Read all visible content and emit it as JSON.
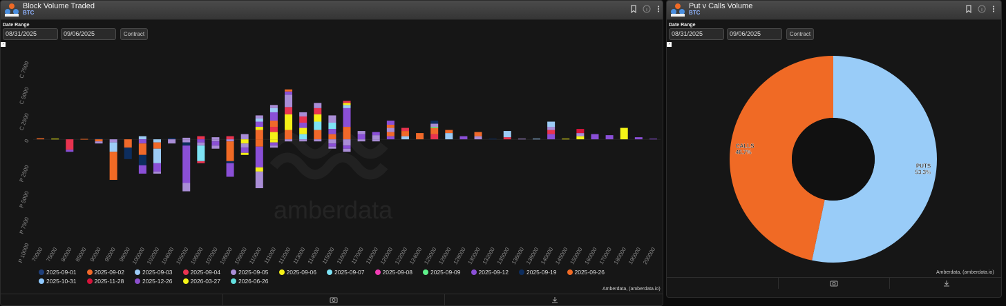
{
  "left_panel": {
    "title": "Block Volume Traded",
    "subtitle": "BTC",
    "date_range_label": "Date Range",
    "date_from": "08/31/2025",
    "date_to": "09/06/2025",
    "contract_button": "Contract",
    "credit": "Amberdata, (amberdata.io)",
    "watermark": "amberdata"
  },
  "right_panel": {
    "title": "Put v Calls Volume",
    "subtitle": "BTC",
    "date_from": "08/31/2025",
    "date_to": "09/06/2025",
    "contract_button": "Contract",
    "credit": "Amberdata, (amberdata.io)"
  },
  "icons": [
    "amberdata-logo-icon",
    "bookmark-icon",
    "info-icon",
    "more-vert-icon",
    "camera-icon",
    "download-icon"
  ],
  "colors": {
    "2025-09-01": "#1f3f7a",
    "2025-09-02": "#f0692a",
    "2025-09-03": "#9ccbf5",
    "2025-09-04": "#e8334f",
    "2025-09-05": "#a98dd6",
    "2025-09-06": "#f5f017",
    "2025-09-07": "#7de3f5",
    "2025-09-08": "#f03cb4",
    "2025-09-09": "#5ef08a",
    "2025-09-12": "#8a4fd6",
    "2025-09-19": "#0d2d5e",
    "2025-09-26": "#f06a25",
    "2025-10-31": "#8fc9ff",
    "2025-11-28": "#d6133a",
    "2025-12-26": "#8b4fcc",
    "2026-03-27": "#f5f517",
    "2026-06-26": "#62dede"
  },
  "chart_data": [
    {
      "type": "bar",
      "stacked": true,
      "y_tick_labels": [
        "C 7500",
        "C 5000",
        "C 2500",
        "0",
        "P 2500",
        "P 5000",
        "P 7500",
        "P 10000"
      ],
      "ylim": [
        -10000,
        7500
      ],
      "categories": [
        "70000",
        "75000",
        "80000",
        "85000",
        "90000",
        "95000",
        "98000",
        "100000",
        "102000",
        "104000",
        "105000",
        "106000",
        "107000",
        "108000",
        "109000",
        "110000",
        "111000",
        "112000",
        "113000",
        "114000",
        "115000",
        "116000",
        "117000",
        "118000",
        "120000",
        "122000",
        "124000",
        "125000",
        "126000",
        "128000",
        "130000",
        "132000",
        "135000",
        "136000",
        "138000",
        "140000",
        "145000",
        "150000",
        "160000",
        "170000",
        "180000",
        "190000",
        "200000"
      ],
      "legend": [
        "2025-09-01",
        "2025-09-02",
        "2025-09-03",
        "2025-09-04",
        "2025-09-05",
        "2025-09-06",
        "2025-09-07",
        "2025-09-08",
        "2025-09-09",
        "2025-09-12",
        "2025-09-19",
        "2025-09-26",
        "2025-10-31",
        "2025-11-28",
        "2025-12-26",
        "2026-03-27",
        "2026-06-26"
      ],
      "calls": [
        [
          [
            "2025-09-26",
            100
          ]
        ],
        [
          [
            "2026-03-27",
            60
          ]
        ],
        [],
        [
          [
            "2025-09-26",
            40
          ]
        ],
        [
          [
            "2025-09-19",
            80
          ]
        ],
        [],
        [],
        [
          [
            "2025-09-03",
            300
          ]
        ],
        [],
        [
          [
            "2025-09-19",
            120
          ]
        ],
        [
          [
            "2025-09-05",
            150
          ]
        ],
        [
          [
            "2025-09-04",
            300
          ]
        ],
        [
          [
            "2025-09-05",
            200
          ]
        ],
        [
          [
            "2025-09-04",
            300
          ]
        ],
        [
          [
            "2025-09-05",
            500
          ]
        ],
        [
          [
            "2025-09-02",
            900
          ],
          [
            "2025-09-06",
            300
          ],
          [
            "2025-09-12",
            500
          ],
          [
            "2025-09-03",
            300
          ],
          [
            "2025-09-05",
            300
          ]
        ],
        [
          [
            "2025-09-06",
            700
          ],
          [
            "2025-09-04",
            500
          ],
          [
            "2025-09-02",
            600
          ],
          [
            "2025-09-12",
            800
          ],
          [
            "2025-09-03",
            400
          ],
          [
            "2025-09-05",
            300
          ]
        ],
        [
          [
            "2025-09-02",
            900
          ],
          [
            "2025-09-06",
            1500
          ],
          [
            "2025-09-04",
            700
          ],
          [
            "2025-09-05",
            1200
          ],
          [
            "2025-09-12",
            300
          ],
          [
            "2025-09-26",
            200
          ]
        ],
        [
          [
            "2025-09-07",
            500
          ],
          [
            "2025-09-06",
            600
          ],
          [
            "2025-09-12",
            500
          ],
          [
            "2025-09-04",
            600
          ],
          [
            "2025-09-05",
            400
          ]
        ],
        [
          [
            "2025-09-02",
            900
          ],
          [
            "2025-09-07",
            800
          ],
          [
            "2025-09-06",
            700
          ],
          [
            "2025-09-04",
            600
          ],
          [
            "2025-09-05",
            500
          ]
        ],
        [
          [
            "2025-09-02",
            500
          ],
          [
            "2025-09-12",
            500
          ],
          [
            "2025-09-07",
            600
          ],
          [
            "2025-09-05",
            700
          ]
        ],
        [
          [
            "2025-09-02",
            1200
          ],
          [
            "2025-09-12",
            1800
          ],
          [
            "2025-09-03",
            300
          ],
          [
            "2025-09-06",
            200
          ],
          [
            "2025-09-04",
            200
          ]
        ],
        [
          [
            "2025-09-12",
            500
          ],
          [
            "2025-09-05",
            300
          ]
        ],
        [
          [
            "2025-09-05",
            400
          ],
          [
            "2025-09-12",
            300
          ]
        ],
        [
          [
            "2025-09-12",
            300
          ],
          [
            "2025-09-02",
            400
          ],
          [
            "2025-09-05",
            400
          ],
          [
            "2025-09-26",
            300
          ],
          [
            "2025-09-12",
            400
          ]
        ],
        [
          [
            "2025-09-03",
            300
          ],
          [
            "2025-09-02",
            500
          ],
          [
            "2025-09-04",
            300
          ]
        ],
        [
          [
            "2025-09-02",
            600
          ]
        ],
        [
          [
            "2025-09-04",
            500
          ],
          [
            "2025-09-02",
            600
          ],
          [
            "2025-09-09",
            100
          ],
          [
            "2025-09-05",
            300
          ],
          [
            "2025-09-19",
            300
          ]
        ],
        [
          [
            "2025-09-03",
            600
          ],
          [
            "2025-09-02",
            300
          ]
        ],
        [
          [
            "2025-09-12",
            300
          ]
        ],
        [
          [
            "2025-09-05",
            300
          ],
          [
            "2025-09-02",
            400
          ]
        ],
        [
          [
            "2025-09-19",
            60
          ]
        ],
        [
          [
            "2025-09-04",
            200
          ],
          [
            "2025-09-03",
            600
          ]
        ],
        [
          [
            "2025-09-05",
            60
          ]
        ],
        [
          [
            "2025-09-03",
            60
          ]
        ],
        [
          [
            "2025-09-12",
            500
          ],
          [
            "2025-09-04",
            400
          ],
          [
            "2025-09-05",
            300
          ],
          [
            "2025-09-03",
            500
          ]
        ],
        [
          [
            "2025-09-06",
            60
          ]
        ],
        [
          [
            "2026-03-27",
            300
          ],
          [
            "2025-09-05",
            300
          ],
          [
            "2025-11-28",
            400
          ]
        ],
        [
          [
            "2025-09-12",
            500
          ]
        ],
        [
          [
            "2025-09-12",
            400
          ]
        ],
        [
          [
            "2026-03-27",
            1100
          ]
        ],
        [
          [
            "2025-09-12",
            200
          ]
        ],
        [
          [
            "2025-09-12",
            60
          ]
        ]
      ],
      "puts": [
        [],
        [],
        [
          [
            "2025-09-04",
            1000
          ],
          [
            "2025-09-12",
            200
          ]
        ],
        [],
        [
          [
            "2025-09-26",
            200
          ],
          [
            "2025-09-05",
            200
          ]
        ],
        [
          [
            "2025-09-05",
            300
          ],
          [
            "2025-09-03",
            900
          ],
          [
            "2025-09-26",
            2700
          ]
        ],
        [
          [
            "2025-09-02",
            800
          ],
          [
            "2025-09-19",
            1100
          ]
        ],
        [
          [
            "2025-09-12",
            400
          ],
          [
            "2025-09-02",
            1100
          ],
          [
            "2025-09-19",
            1000
          ],
          [
            "2025-09-12",
            800
          ]
        ],
        [
          [
            "2025-09-03",
            300
          ],
          [
            "2025-09-02",
            600
          ],
          [
            "2025-09-03",
            1400
          ],
          [
            "2025-09-12",
            800
          ],
          [
            "2025-09-05",
            200
          ]
        ],
        [
          [
            "2025-09-05",
            400
          ]
        ],
        [
          [
            "2025-09-05",
            300
          ],
          [
            "2025-09-19",
            300
          ],
          [
            "2025-09-12",
            3600
          ],
          [
            "2025-09-05",
            800
          ]
        ],
        [
          [
            "2025-09-12",
            300
          ],
          [
            "2025-09-05",
            300
          ],
          [
            "2025-09-07",
            1500
          ],
          [
            "2025-09-04",
            200
          ]
        ],
        [
          [
            "2025-09-05",
            200
          ],
          [
            "2025-09-12",
            400
          ],
          [
            "2025-09-05",
            300
          ]
        ],
        [
          [
            "2025-09-05",
            200
          ],
          [
            "2025-09-26",
            1900
          ],
          [
            "2025-09-19",
            200
          ],
          [
            "2025-09-12",
            1300
          ]
        ],
        [
          [
            "2025-09-06",
            400
          ],
          [
            "2025-09-05",
            400
          ],
          [
            "2025-09-12",
            500
          ],
          [
            "2025-09-06",
            200
          ]
        ],
        [
          [
            "2025-09-26",
            700
          ],
          [
            "2025-09-12",
            2000
          ],
          [
            "2025-09-06",
            400
          ],
          [
            "2025-09-05",
            1600
          ]
        ],
        [
          [
            "2025-09-06",
            300
          ],
          [
            "2025-09-12",
            300
          ],
          [
            "2025-09-05",
            200
          ]
        ],
        [
          [
            "2025-09-05",
            200
          ]
        ],
        [
          [
            "2025-09-05",
            200
          ]
        ],
        [
          [
            "2025-09-05",
            200
          ]
        ],
        [
          [
            "2025-09-05",
            400
          ],
          [
            "2025-09-12",
            300
          ],
          [
            "2025-09-05",
            200
          ]
        ],
        [
          [
            "2025-09-05",
            600
          ],
          [
            "2025-09-12",
            300
          ],
          [
            "2025-09-05",
            300
          ]
        ],
        [
          [
            "2025-09-05",
            200
          ]
        ],
        [
          [
            "2025-09-05",
            200
          ]
        ],
        [],
        [],
        [],
        [],
        [],
        [],
        [],
        [],
        [],
        [],
        [],
        [],
        [],
        [],
        [],
        [],
        [],
        [],
        []
      ]
    },
    {
      "type": "pie",
      "donut": true,
      "slices": [
        {
          "label": "PUTS",
          "value": 53.3,
          "text": "53.3%",
          "color": "#99ccf8"
        },
        {
          "label": "CALLS",
          "value": 46.7,
          "text": "46.7%",
          "color": "#f06a25"
        }
      ]
    }
  ]
}
